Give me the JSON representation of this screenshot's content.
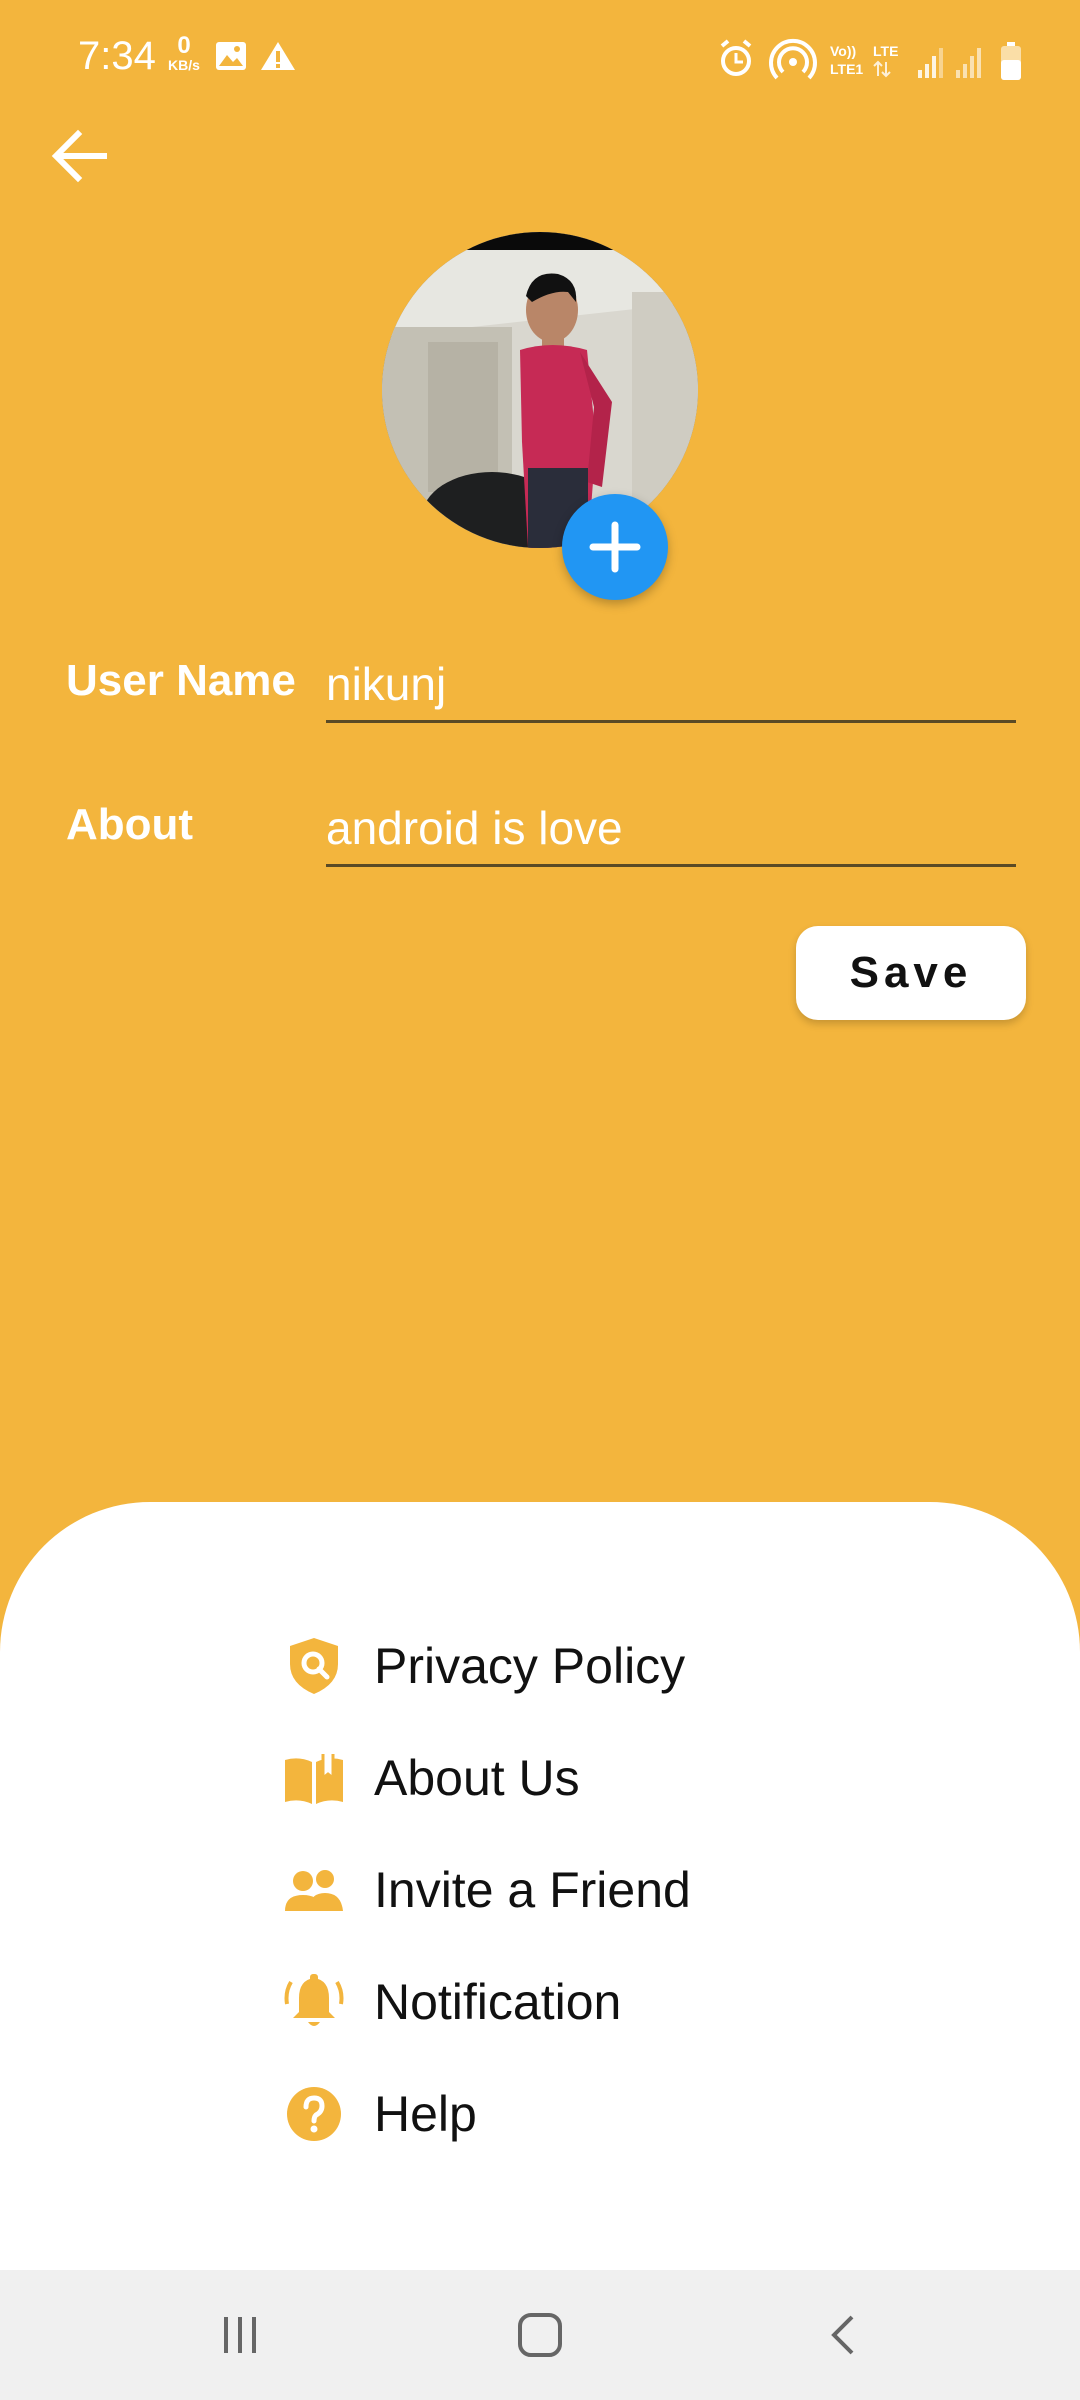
{
  "status_bar": {
    "time": "7:34",
    "net_speed_value": "0",
    "net_speed_unit": "KB/s",
    "network": "Vo) LTE LTE1"
  },
  "header": {
    "back_icon": "arrow-left-icon"
  },
  "profile": {
    "avatar_alt": "Profile photo",
    "add_icon": "plus-icon"
  },
  "form": {
    "username_label": "User Name",
    "username_value": "nikunj",
    "about_label": "About",
    "about_value": "android is love",
    "save_label": "Save"
  },
  "menu": {
    "items": [
      {
        "label": "Privacy Policy",
        "icon": "shield-search-icon"
      },
      {
        "label": "About Us",
        "icon": "book-open-icon"
      },
      {
        "label": "Invite a Friend",
        "icon": "people-icon"
      },
      {
        "label": "Notification",
        "icon": "bell-ringing-icon"
      },
      {
        "label": "Help",
        "icon": "help-circle-icon"
      }
    ]
  },
  "colors": {
    "background": "#F3B53D",
    "accent_blue": "#2196F3",
    "sheet": "#FFFFFF",
    "nav_bar": "#F0F0F0"
  }
}
